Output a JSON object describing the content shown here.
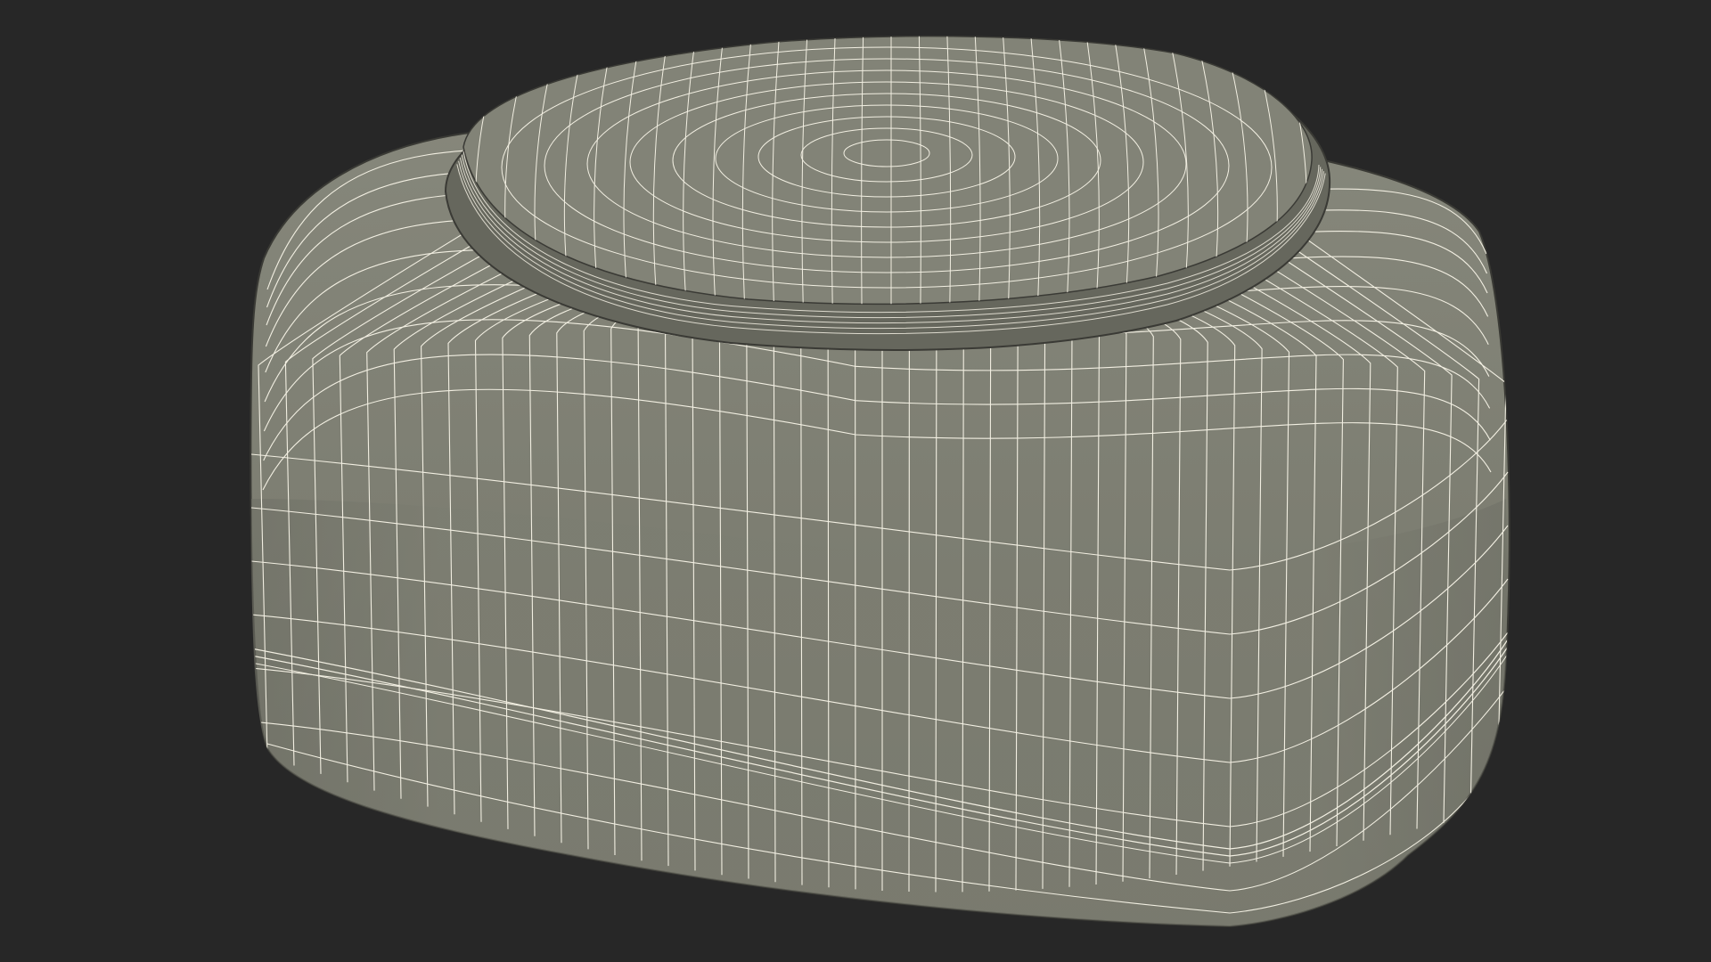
{
  "scene": {
    "subject": "wireframe-mesh-rounded-container-with-lid",
    "colors": {
      "background": "#272727",
      "surface": "#7d7e72",
      "surface_dark": "#5f6056",
      "wire": "#f2efe2"
    }
  }
}
